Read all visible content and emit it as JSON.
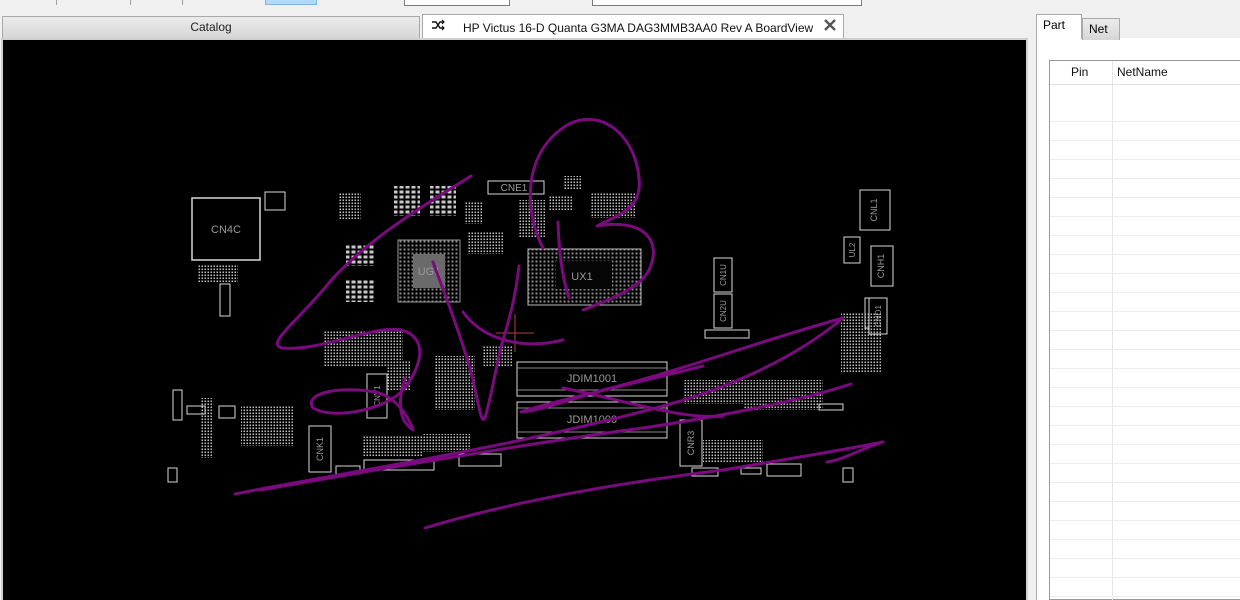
{
  "tabs": {
    "catalog_label": "Catalog",
    "board_label": "HP Victus 16-D Quanta G3MA DAG3MMB3AA0 Rev A BoardView"
  },
  "icons": {
    "pin": "pin-icon",
    "close": "close-icon"
  },
  "right_panel": {
    "tabs": [
      "Part",
      "Net"
    ],
    "columns": [
      "Pin",
      "NetName"
    ]
  },
  "board": {
    "labels": {
      "cn4c": "CN4C",
      "cne1": "CNE1",
      "ux1": "UX1",
      "ug1": "UG1",
      "jdim1001": "JDIM1001",
      "jdim1000": "JDIM1000",
      "cnl1": "CNL1",
      "cnh1": "CNH1",
      "cnd1": "CND1",
      "cn1u": "CN1U",
      "cn2u": "CN2U",
      "cnk1": "CNK1",
      "cnr3": "CNR3",
      "ul2": "UL2",
      "cnv1": "CNV1"
    },
    "colors": {
      "background": "#000000",
      "outline": "#d8d8d8",
      "annotation": "#7a0a7e",
      "crosshair": "#b04040"
    }
  }
}
